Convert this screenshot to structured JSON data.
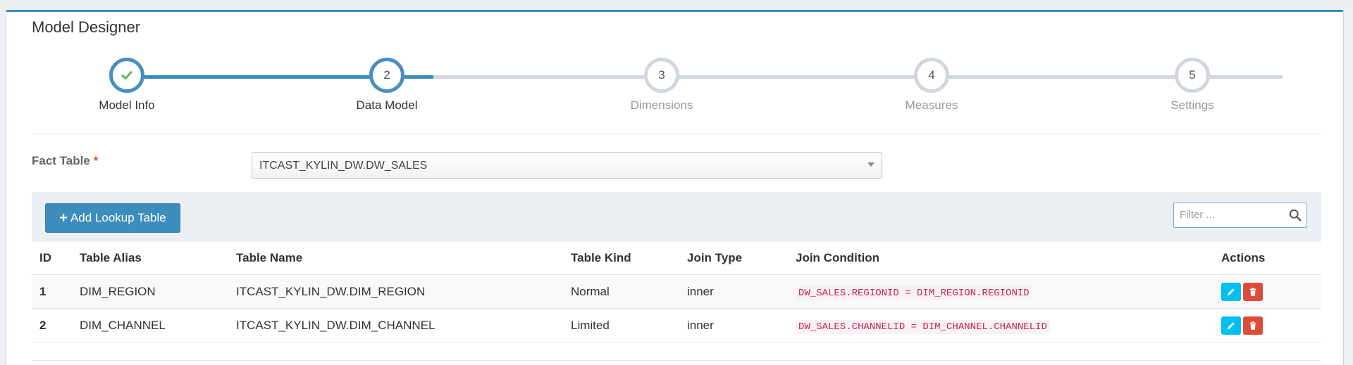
{
  "page": {
    "title": "Model Designer"
  },
  "wizard": {
    "steps": [
      {
        "number": "",
        "label": "Model Info",
        "state": "completed"
      },
      {
        "number": "2",
        "label": "Data Model",
        "state": "active"
      },
      {
        "number": "3",
        "label": "Dimensions",
        "state": "pending"
      },
      {
        "number": "4",
        "label": "Measures",
        "state": "pending"
      },
      {
        "number": "5",
        "label": "Settings",
        "state": "pending"
      }
    ]
  },
  "fact_table": {
    "label": "Fact Table",
    "required_mark": "*",
    "value": "ITCAST_KYLIN_DW.DW_SALES"
  },
  "toolbar": {
    "add_button_icon": "+",
    "add_button_label": "Add Lookup Table",
    "filter_placeholder": "Filter ..."
  },
  "table": {
    "headers": {
      "id": "ID",
      "alias": "Table Alias",
      "name": "Table Name",
      "kind": "Table Kind",
      "join_type": "Join Type",
      "join_condition": "Join Condition",
      "actions": "Actions"
    },
    "rows": [
      {
        "id": "1",
        "alias": "DIM_REGION",
        "name": "ITCAST_KYLIN_DW.DIM_REGION",
        "kind": "Normal",
        "join_type": "inner",
        "join_condition": "DW_SALES.REGIONID = DIM_REGION.REGIONID"
      },
      {
        "id": "2",
        "alias": "DIM_CHANNEL",
        "name": "ITCAST_KYLIN_DW.DIM_CHANNEL",
        "kind": "Limited",
        "join_type": "inner",
        "join_condition": "DW_SALES.CHANNELID = DIM_CHANNEL.CHANNELID"
      }
    ]
  },
  "colors": {
    "primary": "#3c8dbc",
    "check": "#5cb85c",
    "edit": "#00c0ef",
    "delete": "#dd4b39",
    "code": "#c7254e"
  }
}
